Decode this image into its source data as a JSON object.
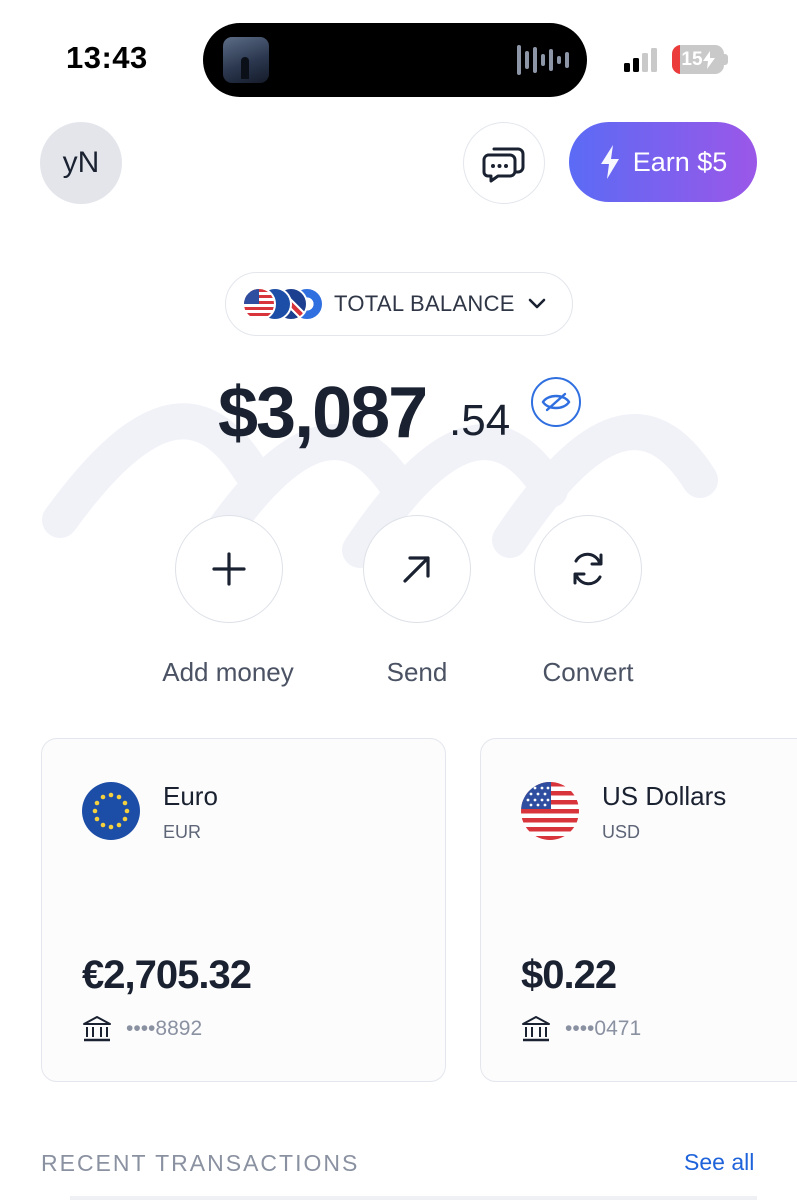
{
  "status_bar": {
    "time": "13:43",
    "battery_level": "15",
    "battery_fraction": 0.15,
    "signal_bars_active": 2,
    "signal_bars_total": 4,
    "now_playing_icon": "album-art",
    "audio_indicator_icon": "waveform-icon"
  },
  "header": {
    "avatar_initials": "yN",
    "chat_icon": "chat-bubbles-icon",
    "earn_label": "Earn $5",
    "earn_icon": "lightning-icon",
    "accent_gradient": [
      "#5b6bf5",
      "#9b57e8"
    ]
  },
  "balance": {
    "selector_label": "TOTAL BALANCE",
    "selector_icon": "chevron-down-icon",
    "flag_icons": [
      "us-flag",
      "eu-flag",
      "uk-flag",
      "currency-flag"
    ],
    "amount_main": "$3,087",
    "amount_cents": ".54",
    "visibility_icon": "eye-off-icon"
  },
  "actions": [
    {
      "label": "Add money",
      "icon": "plus-icon"
    },
    {
      "label": "Send",
      "icon": "arrow-up-right-icon"
    },
    {
      "label": "Convert",
      "icon": "refresh-icon"
    }
  ],
  "accounts": [
    {
      "name": "Euro",
      "code": "EUR",
      "amount": "€2,705.32",
      "account": "••••8892",
      "flag_icon": "eu-flag",
      "bank_icon": "bank-icon"
    },
    {
      "name": "US Dollars",
      "code": "USD",
      "amount": "$0.22",
      "account": "••••0471",
      "flag_icon": "us-flag",
      "bank_icon": "bank-icon"
    }
  ],
  "recent": {
    "title": "RECENT TRANSACTIONS",
    "see_all": "See all"
  },
  "colors": {
    "text_primary": "#1a2130",
    "link_blue": "#1f63db",
    "muted": "#8a91a1"
  }
}
